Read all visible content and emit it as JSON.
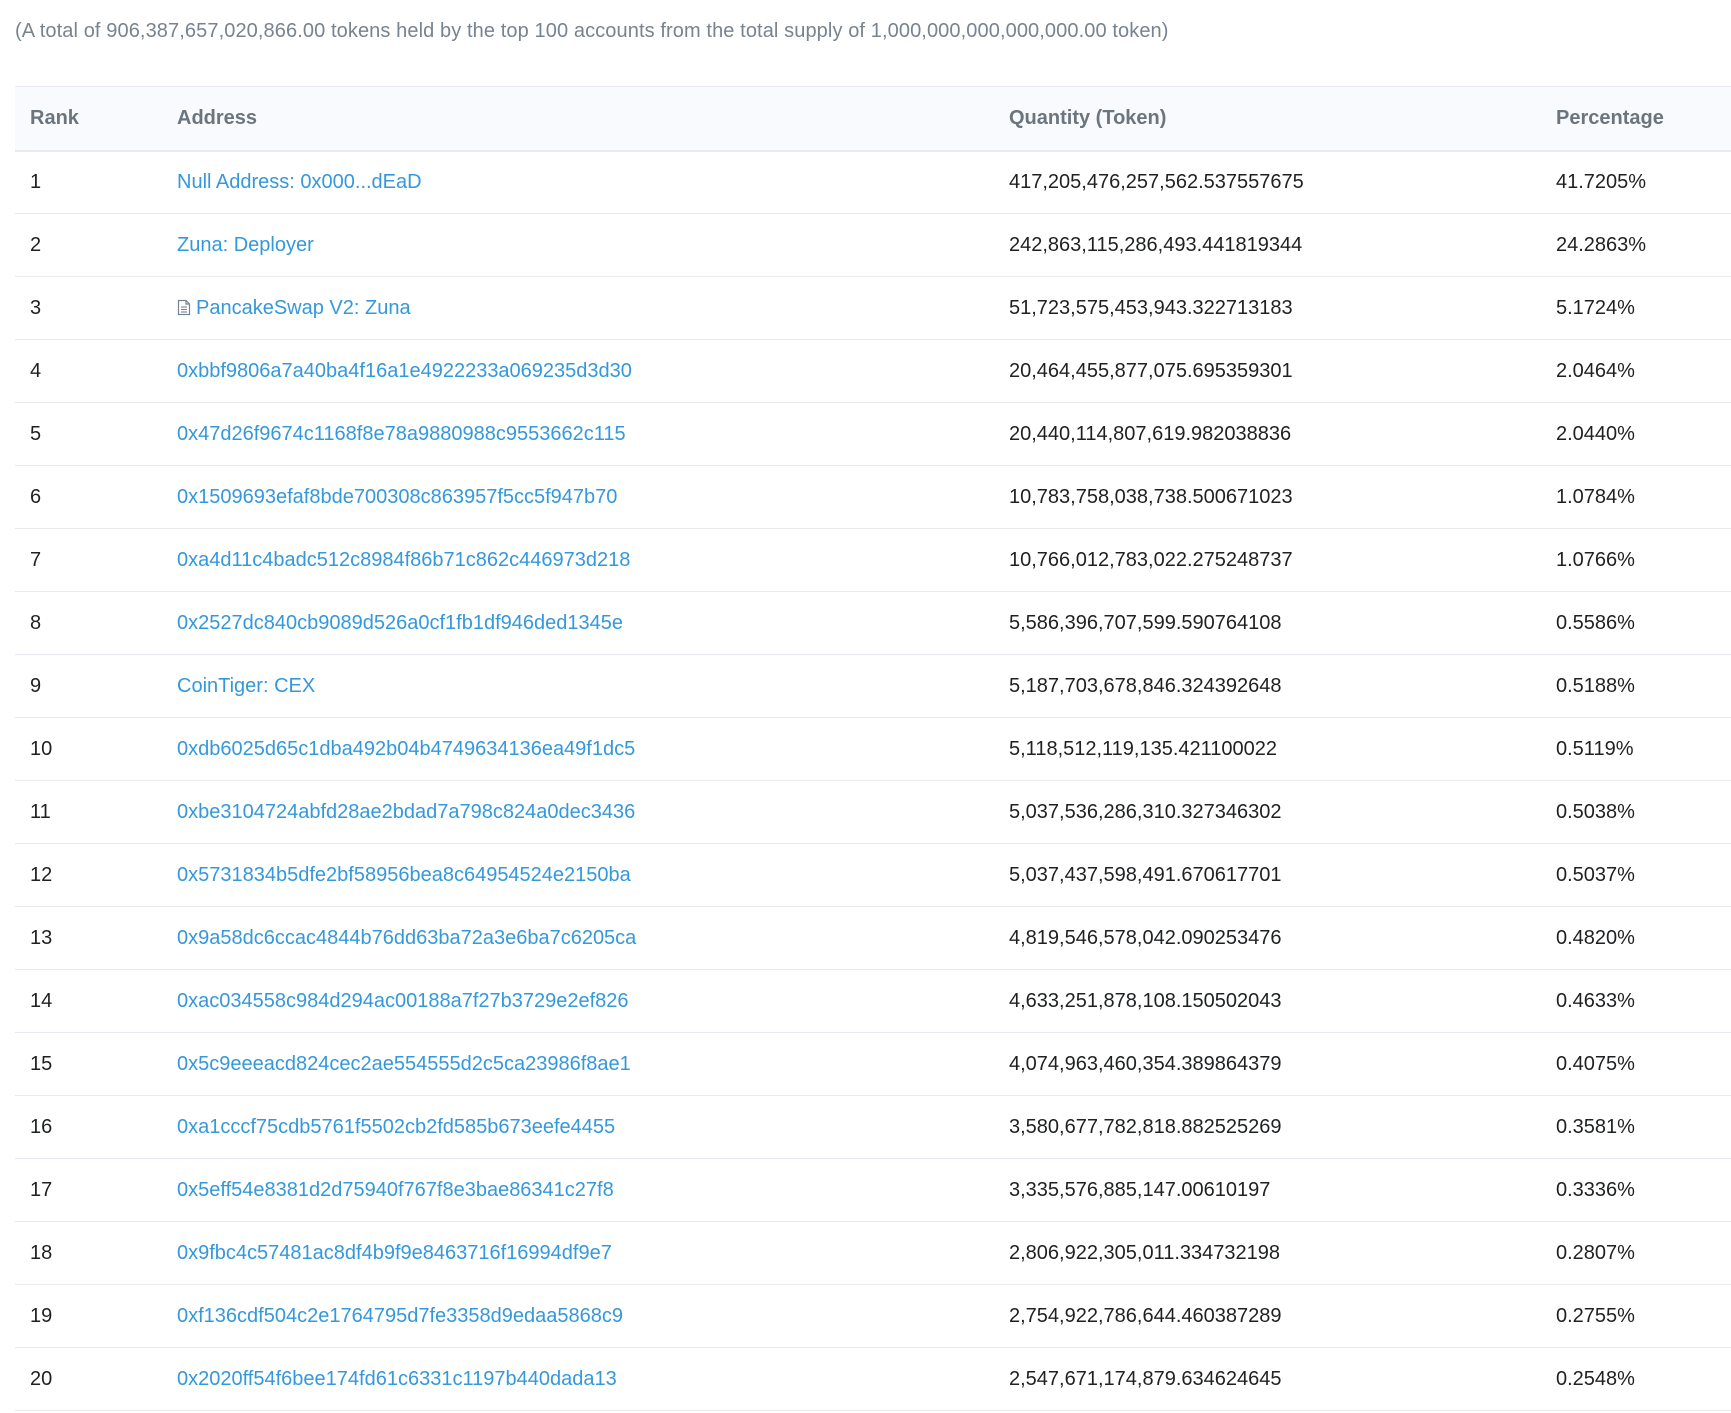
{
  "summary": "(A total of 906,387,657,020,866.00 tokens held by the top 100 accounts from the total supply of 1,000,000,000,000,000.00 token)",
  "table": {
    "headers": {
      "rank": "Rank",
      "address": "Address",
      "quantity": "Quantity (Token)",
      "percentage": "Percentage"
    },
    "rows": [
      {
        "rank": "1",
        "address": "Null Address: 0x000...dEaD",
        "quantity": "417,205,476,257,562.537557675",
        "percentage": "41.7205%",
        "icon": ""
      },
      {
        "rank": "2",
        "address": "Zuna: Deployer",
        "quantity": "242,863,115,286,493.441819344",
        "percentage": "24.2863%",
        "icon": ""
      },
      {
        "rank": "3",
        "address": "PancakeSwap V2: Zuna",
        "quantity": "51,723,575,453,943.322713183",
        "percentage": "5.1724%",
        "icon": "contract-file-icon"
      },
      {
        "rank": "4",
        "address": "0xbbf9806a7a40ba4f16a1e4922233a069235d3d30",
        "quantity": "20,464,455,877,075.695359301",
        "percentage": "2.0464%",
        "icon": ""
      },
      {
        "rank": "5",
        "address": "0x47d26f9674c1168f8e78a9880988c9553662c115",
        "quantity": "20,440,114,807,619.982038836",
        "percentage": "2.0440%",
        "icon": ""
      },
      {
        "rank": "6",
        "address": "0x1509693efaf8bde700308c863957f5cc5f947b70",
        "quantity": "10,783,758,038,738.500671023",
        "percentage": "1.0784%",
        "icon": ""
      },
      {
        "rank": "7",
        "address": "0xa4d11c4badc512c8984f86b71c862c446973d218",
        "quantity": "10,766,012,783,022.275248737",
        "percentage": "1.0766%",
        "icon": ""
      },
      {
        "rank": "8",
        "address": "0x2527dc840cb9089d526a0cf1fb1df946ded1345e",
        "quantity": "5,586,396,707,599.590764108",
        "percentage": "0.5586%",
        "icon": ""
      },
      {
        "rank": "9",
        "address": "CoinTiger: CEX",
        "quantity": "5,187,703,678,846.324392648",
        "percentage": "0.5188%",
        "icon": ""
      },
      {
        "rank": "10",
        "address": "0xdb6025d65c1dba492b04b4749634136ea49f1dc5",
        "quantity": "5,118,512,119,135.421100022",
        "percentage": "0.5119%",
        "icon": ""
      },
      {
        "rank": "11",
        "address": "0xbe3104724abfd28ae2bdad7a798c824a0dec3436",
        "quantity": "5,037,536,286,310.327346302",
        "percentage": "0.5038%",
        "icon": ""
      },
      {
        "rank": "12",
        "address": "0x5731834b5dfe2bf58956bea8c64954524e2150ba",
        "quantity": "5,037,437,598,491.670617701",
        "percentage": "0.5037%",
        "icon": ""
      },
      {
        "rank": "13",
        "address": "0x9a58dc6ccac4844b76dd63ba72a3e6ba7c6205ca",
        "quantity": "4,819,546,578,042.090253476",
        "percentage": "0.4820%",
        "icon": ""
      },
      {
        "rank": "14",
        "address": "0xac034558c984d294ac00188a7f27b3729e2ef826",
        "quantity": "4,633,251,878,108.150502043",
        "percentage": "0.4633%",
        "icon": ""
      },
      {
        "rank": "15",
        "address": "0x5c9eeeacd824cec2ae554555d2c5ca23986f8ae1",
        "quantity": "4,074,963,460,354.389864379",
        "percentage": "0.4075%",
        "icon": ""
      },
      {
        "rank": "16",
        "address": "0xa1cccf75cdb5761f5502cb2fd585b673eefe4455",
        "quantity": "3,580,677,782,818.882525269",
        "percentage": "0.3581%",
        "icon": ""
      },
      {
        "rank": "17",
        "address": "0x5eff54e8381d2d75940f767f8e3bae86341c27f8",
        "quantity": "3,335,576,885,147.00610197",
        "percentage": "0.3336%",
        "icon": ""
      },
      {
        "rank": "18",
        "address": "0x9fbc4c57481ac8df4b9f9e8463716f16994df9e7",
        "quantity": "2,806,922,305,011.334732198",
        "percentage": "0.2807%",
        "icon": ""
      },
      {
        "rank": "19",
        "address": "0xf136cdf504c2e1764795d7fe3358d9edaa5868c9",
        "quantity": "2,754,922,786,644.460387289",
        "percentage": "0.2755%",
        "icon": ""
      },
      {
        "rank": "20",
        "address": "0x2020ff54f6bee174fd61c6331c1197b440dada13",
        "quantity": "2,547,671,174,879.634624645",
        "percentage": "0.2548%",
        "icon": ""
      }
    ]
  },
  "colors": {
    "link": "#3498db",
    "header_bg": "#f8fafd",
    "border": "#e7eaf3",
    "muted_text": "#77838f"
  }
}
